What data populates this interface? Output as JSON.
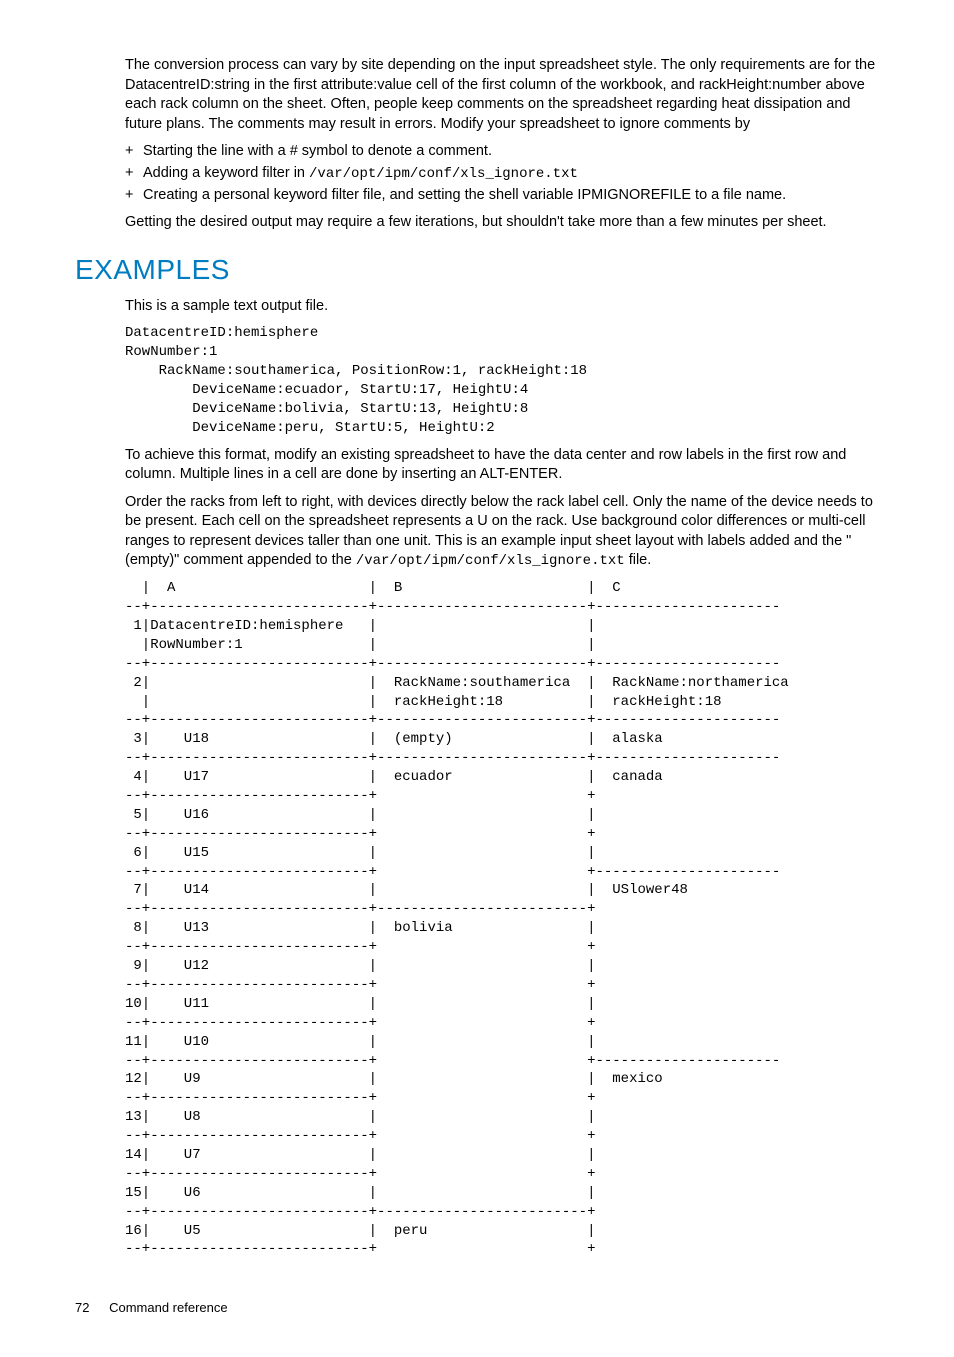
{
  "intro": {
    "p1": "The conversion process can vary by site depending on the input spreadsheet style. The only requirements are for the DatacentreID:string in the first attribute:value cell of the first column of the workbook, and rackHeight:number above each rack column on the sheet. Often, people keep comments on the spreadsheet regarding heat dissipation and future plans. The comments may result in errors. Modify your spreadsheet to ignore comments by",
    "bullets": {
      "b1": "Starting the line with a # symbol to denote a comment.",
      "b2a": "Adding a keyword filter in ",
      "b2code": "/var/opt/ipm/conf/xls_ignore.txt",
      "b3": "Creating a personal keyword filter file, and setting the shell variable IPMIGNOREFILE to a file name."
    },
    "p2": "Getting the desired output may require a few iterations, but shouldn't take more than a few minutes per sheet."
  },
  "examples": {
    "heading": "Examples",
    "p1": "This is a sample text output file.",
    "code1": "DatacentreID:hemisphere\nRowNumber:1\n    RackName:southamerica, PositionRow:1, rackHeight:18\n        DeviceName:ecuador, StartU:17, HeightU:4\n        DeviceName:bolivia, StartU:13, HeightU:8\n        DeviceName:peru, StartU:5, HeightU:2",
    "p2": "To achieve this format, modify an existing spreadsheet to have the data center and row labels in the first row and column. Multiple lines in a cell are done by inserting an ALT-ENTER.",
    "p3a": "Order the racks from left to right, with devices directly below the rack label cell. Only the name of the device needs to be present. Each cell on the spreadsheet represents a U on the rack. Use background color differences or multi-cell ranges to represent devices taller than one unit. This is an example input sheet layout with labels added and the \"(empty)\" comment appended to the ",
    "p3code": "/var/opt/ipm/conf/xls_ignore.txt",
    "p3b": " file.",
    "table": "  |  A                       |  B                      |  C\n--+--------------------------+-------------------------+----------------------\n 1|DatacentreID:hemisphere   |                         |\n  |RowNumber:1               |                         |\n--+--------------------------+-------------------------+----------------------\n 2|                          |  RackName:southamerica  |  RackName:northamerica\n  |                          |  rackHeight:18          |  rackHeight:18\n--+--------------------------+-------------------------+----------------------\n 3|    U18                   |  (empty)                |  alaska\n--+--------------------------+-------------------------+----------------------\n 4|    U17                   |  ecuador                |  canada\n--+--------------------------+                         +\n 5|    U16                   |                         |\n--+--------------------------+                         +\n 6|    U15                   |                         |\n--+--------------------------+                         +----------------------\n 7|    U14                   |                         |  USlower48\n--+--------------------------+-------------------------+\n 8|    U13                   |  bolivia                |\n--+--------------------------+                         +\n 9|    U12                   |                         |\n--+--------------------------+                         +\n10|    U11                   |                         |\n--+--------------------------+                         +\n11|    U10                   |                         |\n--+--------------------------+                         +----------------------\n12|    U9                    |                         |  mexico\n--+--------------------------+                         +\n13|    U8                    |                         |\n--+--------------------------+                         +\n14|    U7                    |                         |\n--+--------------------------+                         +\n15|    U6                    |                         |\n--+--------------------------+-------------------------+\n16|    U5                    |  peru                   |\n--+--------------------------+                         +"
  },
  "footer": {
    "page": "72",
    "section": "Command reference"
  }
}
